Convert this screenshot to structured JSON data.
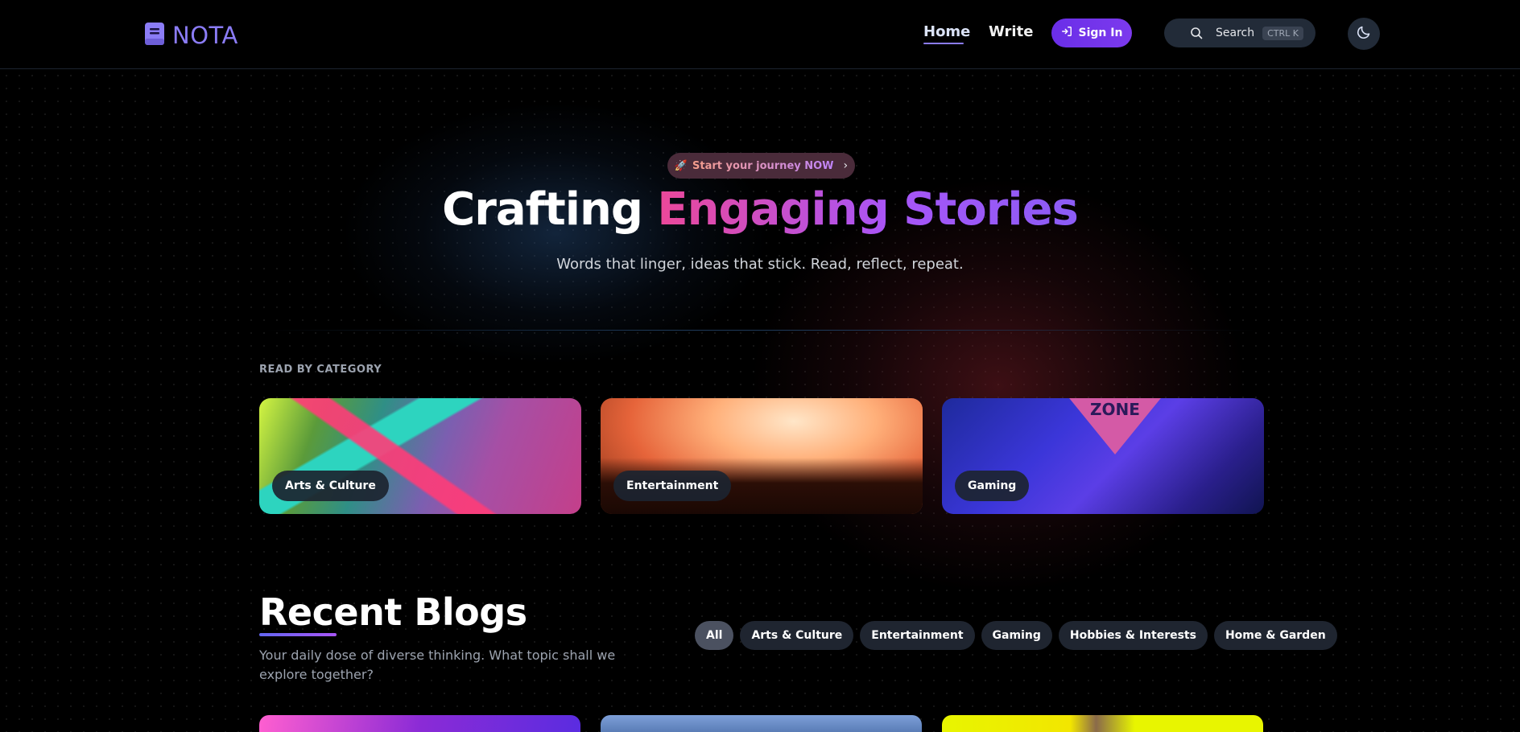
{
  "header": {
    "brand": "NOTA",
    "nav": {
      "home": "Home",
      "write": "Write"
    },
    "signin_label": "Sign In",
    "search_label": "Search",
    "search_shortcut": "CTRL K"
  },
  "hero": {
    "badge_emoji": "🚀",
    "badge_text": "Start your journey NOW",
    "title_plain": "Crafting",
    "title_gradient": "Engaging Stories",
    "subtitle": "Words that linger, ideas that stick. Read, reflect, repeat."
  },
  "categories": {
    "heading": "READ BY CATEGORY",
    "items": [
      {
        "label": "Arts & Culture"
      },
      {
        "label": "Entertainment"
      },
      {
        "label": "Gaming"
      }
    ],
    "gaming_sign_text": "ZONE"
  },
  "recent": {
    "title": "Recent Blogs",
    "subtitle": "Your daily dose of diverse thinking. What topic shall we explore together?",
    "filters": [
      "All",
      "Arts & Culture",
      "Entertainment",
      "Gaming",
      "Hobbies & Interests",
      "Home & Garden"
    ],
    "active_filter": "All"
  },
  "colors": {
    "accent": "#8b7cf6",
    "signin_bg": "#6d28d9",
    "gradient_title": [
      "#ec4899",
      "#8b5cf6"
    ]
  },
  "icons": {
    "logo": "book-icon",
    "signin": "login-arrow-icon",
    "search": "search-icon",
    "theme": "moon-icon",
    "badge_chevron": "chevron-right-icon"
  }
}
